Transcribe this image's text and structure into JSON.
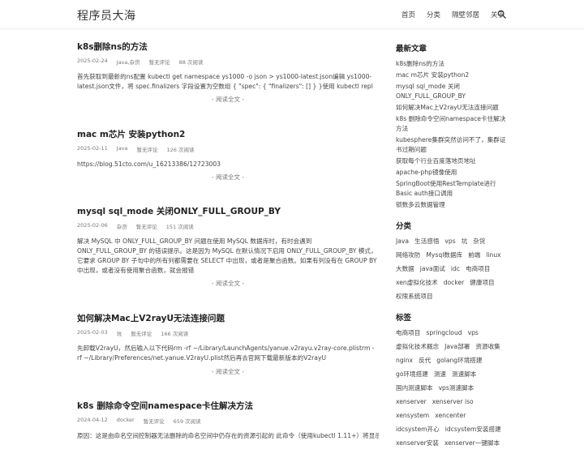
{
  "header": {
    "site_title": "程序员大海",
    "nav": [
      "首页",
      "分类",
      "隔壁邻居",
      "关于"
    ]
  },
  "posts": [
    {
      "title": "k8s删除ns的方法",
      "date": "2025-02-24",
      "category": "Java,杂货",
      "comments": "暂无评论",
      "views": "88 次阅读",
      "excerpt": "首先获取到最新的ns配置 kubectl get namespace ys1000 -o json > ys1000-latest.json编辑 ys1000-latest.json文件，将 spec.finalizers 字段设置为空数组 { \"spec\": { \"finalizers\": [] } }使用 kubectl repl",
      "readmore": "- 阅读全文 -"
    },
    {
      "title": "mac m芯片 安装python2",
      "date": "2025-02-11",
      "category": "Java",
      "comments": "暂无评论",
      "views": "126 次阅读",
      "excerpt": "https://blog.51cto.com/u_16213386/12723003",
      "readmore": "- 阅读全文 -"
    },
    {
      "title": "mysql sql_mode 关闭ONLY_FULL_GROUP_BY",
      "date": "2025-02-06",
      "category": "杂货",
      "comments": "暂无评论",
      "views": "151 次阅读",
      "excerpt": "解决 MySQL 中 ONLY_FULL_GROUP_BY 问题在使用 MySQL 数据库时，有时会遇到 ONLY_FULL_GROUP_BY 的错误提示。这是因为 MySQL 在默认情况下启用 ONLY_FULL_GROUP_BY 模式，它要求 GROUP BY 子句中的所有列都需要在 SELECT 中出现，或者是聚合函数。如果有列没有在 GROUP BY 中出现，或者没有使用聚合函数，就会报错",
      "readmore": "- 阅读全文 -"
    },
    {
      "title": "如何解决Mac上V2rayU无法连接问题",
      "date": "2025-02-03",
      "category": "坑",
      "comments": "暂无评论",
      "views": "166 次阅读",
      "excerpt": "先卸载V2rayU，然后输入以下代码rm -rf ~/Library/LaunchAgents/yanue.v2rayu.v2ray-core.plistrm -rf ~/Library/Preferences/net.yanue.V2rayU.plist然后再去官网下载最新版本的V2rayU",
      "readmore": "- 阅读全文 -"
    },
    {
      "title": "k8s 删除命令空间namespace卡住解决方法",
      "date": "2024-04-12",
      "category": "docker",
      "comments": "暂无评论",
      "views": "659 次阅读",
      "excerpt": "原因：这是由命名空间控制器无法删除的命名空间中仍存在的资源引起的 此命令（使用kubectl 1.11+）将显示命",
      "readmore": ""
    }
  ],
  "sidebar": {
    "recent_title": "最新文章",
    "recent": [
      "k8s删除ns的方法",
      "mac m芯片 安装python2",
      "mysql sql_mode 关闭ONLY_FULL_GROUP_BY",
      "如何解决Mac上V2rayU无法连接问题",
      "k8s 删除命令空间namespace卡住解决方法",
      "kubesphere集群突然访问不了，集群证书过期问题",
      "获取每个行业百度落地页地址",
      "apache-php镜像使用",
      "SpringBoot使用RestTemplate进行Basic auth接口调用",
      "锁数多云数据管理"
    ],
    "categories_title": "分类",
    "categories": [
      "Java",
      "生活感悟",
      "vps",
      "坑",
      "杂货",
      "网络攻防",
      "Mysql数据库",
      "前端",
      "linux",
      "大数据",
      "java面试",
      "idc",
      "电商项目",
      "xen虚拟化技术",
      "docker",
      "健康项目",
      "权限系统项目"
    ],
    "tags_title": "标签",
    "tags": [
      "电商项目",
      "springcloud",
      "vps",
      "虚拟化技术概念",
      "Java部署",
      "资源收集",
      "nginx",
      "反代",
      "golang环境搭建",
      "go环境搭建",
      "测速",
      "测速脚本",
      "国内测速脚本",
      "vps测速脚本",
      "xenserver",
      "xenserver iso",
      "xensystem",
      "xencenter",
      "idcsystem开心",
      "idcsystem安装搭建",
      "xenserver安装",
      "xenserver一键脚本"
    ]
  }
}
